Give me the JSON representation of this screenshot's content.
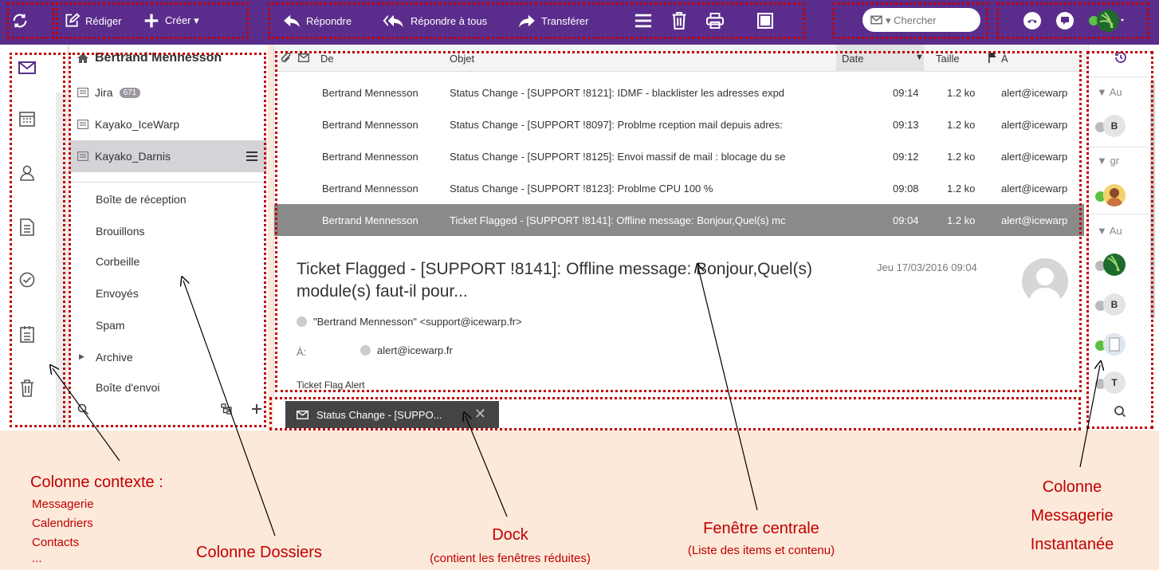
{
  "toolbar": {
    "compose_label": "Rédiger",
    "create_label": "Créer ▾",
    "reply_label": "Répondre",
    "reply_all_label": "Répondre à tous",
    "forward_label": "Transférer",
    "search_placeholder": "▾ Chercher"
  },
  "folders": {
    "account_name": "Bertrand Mennesson",
    "items": [
      {
        "label": "Jira",
        "badge": "671"
      },
      {
        "label": "Kayako_IceWarp"
      },
      {
        "label": "Kayako_Darnis"
      }
    ],
    "subfolders": [
      "Boîte de réception",
      "Brouillons",
      "Corbeille",
      "Envoyés",
      "Spam",
      "Archive",
      "Boîte d'envoi"
    ]
  },
  "list": {
    "headers": {
      "from": "De",
      "subject": "Objet",
      "date": "Date",
      "size": "Taille",
      "to": "À"
    },
    "rows": [
      {
        "from": "Bertrand Mennesson",
        "subject": "Status Change - [SUPPORT !8121]: IDMF - blacklister les adresses expd",
        "date": "09:14",
        "size": "1.2 ko",
        "to": "alert@icewarp"
      },
      {
        "from": "Bertrand Mennesson",
        "subject": "Status Change - [SUPPORT !8097]: Problme rception mail depuis adres:",
        "date": "09:13",
        "size": "1.2 ko",
        "to": "alert@icewarp"
      },
      {
        "from": "Bertrand Mennesson",
        "subject": "Status Change - [SUPPORT !8125]: Envoi massif de mail : blocage du se",
        "date": "09:12",
        "size": "1.2 ko",
        "to": "alert@icewarp"
      },
      {
        "from": "Bertrand Mennesson",
        "subject": "Status Change - [SUPPORT !8123]: Problme CPU 100 %",
        "date": "09:08",
        "size": "1.2 ko",
        "to": "alert@icewarp"
      },
      {
        "from": "Bertrand Mennesson",
        "subject": "Ticket Flagged - [SUPPORT !8141]: Offline message: Bonjour,Quel(s) mc",
        "date": "09:04",
        "size": "1.2 ko",
        "to": "alert@icewarp"
      }
    ]
  },
  "preview": {
    "title": "Ticket Flagged - [SUPPORT !8141]: Offline message: Bonjour,Quel(s) module(s) faut-il pour...",
    "date": "Jeu 17/03/2016 09:04",
    "from": "\"Bertrand Mennesson\" <support@icewarp.fr>",
    "to_label": "À:",
    "to": "alert@icewarp.fr",
    "body": "Ticket Flag Alert"
  },
  "dock": {
    "item": "Status Change - [SUPPO..."
  },
  "im": {
    "groups": [
      "Au",
      "gr",
      "Au"
    ],
    "initials": [
      "B",
      "B",
      "T"
    ]
  },
  "annotations": {
    "context_title": "Colonne contexte :",
    "context_items": [
      "Messagerie",
      "Calendriers",
      "Contacts",
      "..."
    ],
    "folders_title": "Colonne Dossiers",
    "dock_title": "Dock",
    "dock_sub": "(contient les fenêtres réduites)",
    "central_title": "Fenêtre centrale",
    "central_sub": "(Liste des items et contenu)",
    "im_title_1": "Colonne",
    "im_title_2": "Messagerie",
    "im_title_3": "Instantanée"
  },
  "colors": {
    "toolbar": "#5a2d8c",
    "annotation": "#c00000",
    "background": "#fce9da",
    "selected_row": "#8a8a8a",
    "online": "#5cc143"
  }
}
